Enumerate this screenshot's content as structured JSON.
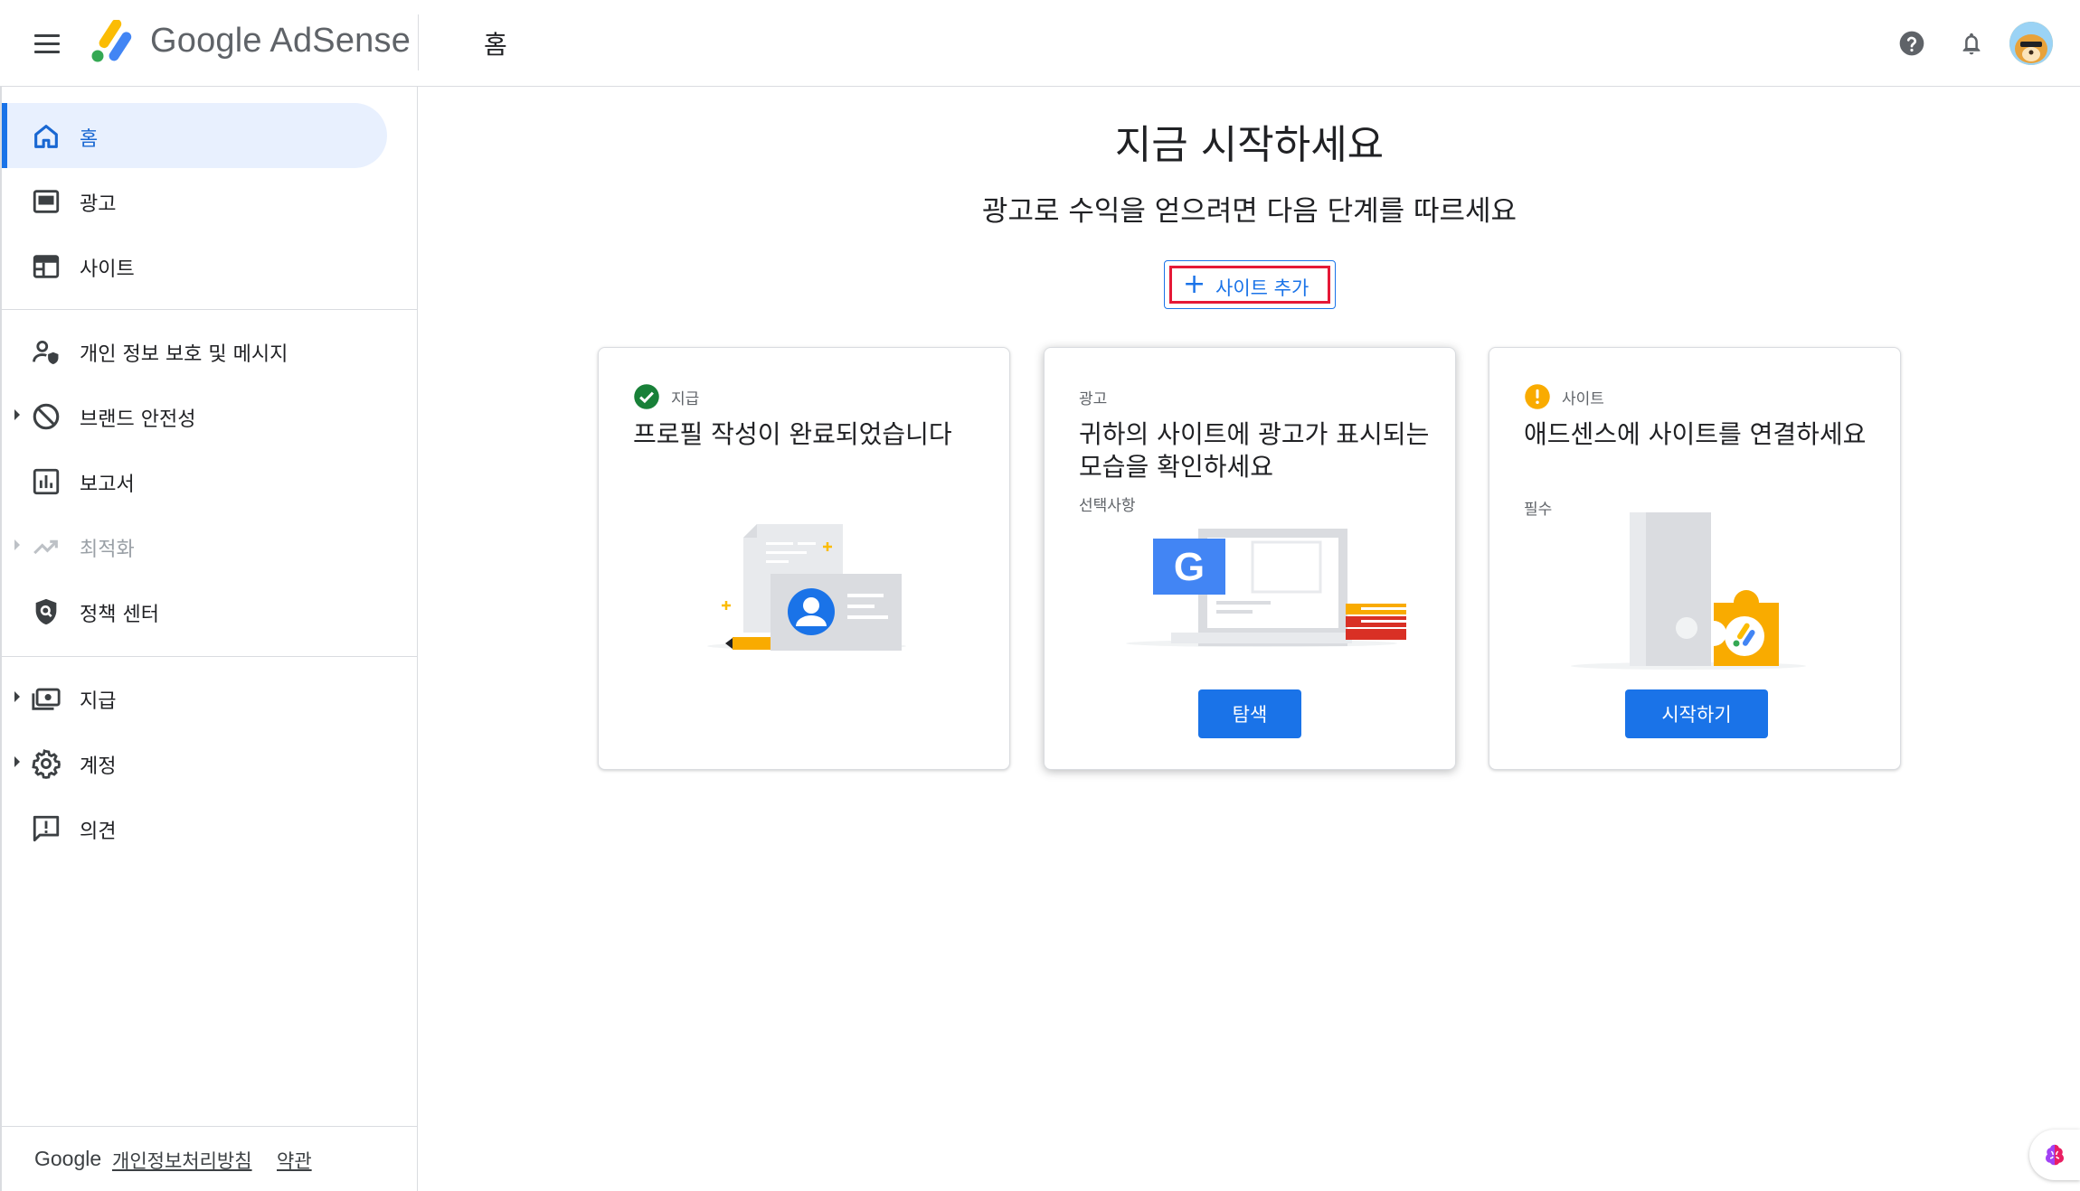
{
  "header": {
    "brand": "Google AdSense",
    "page_title": "홈",
    "icons": [
      "menu-icon",
      "help-icon",
      "notifications-icon",
      "avatar"
    ]
  },
  "sidebar": {
    "items": [
      {
        "label": "홈",
        "icon": "home-icon",
        "active": true
      },
      {
        "label": "광고",
        "icon": "ads-icon"
      },
      {
        "label": "사이트",
        "icon": "sites-icon"
      },
      {
        "label": "개인 정보 보호 및 메시지",
        "icon": "privacy-icon"
      },
      {
        "label": "브랜드 안전성",
        "icon": "block-icon",
        "expandable": true
      },
      {
        "label": "보고서",
        "icon": "reports-icon"
      },
      {
        "label": "최적화",
        "icon": "trending-icon",
        "expandable": true,
        "disabled": true
      },
      {
        "label": "정책 센터",
        "icon": "policy-icon"
      },
      {
        "label": "지급",
        "icon": "payments-icon",
        "expandable": true
      },
      {
        "label": "계정",
        "icon": "settings-icon",
        "expandable": true
      },
      {
        "label": "의견",
        "icon": "feedback-icon"
      }
    ],
    "footer": {
      "brand": "Google",
      "privacy_link": "개인정보처리방침",
      "terms_link": "약관"
    }
  },
  "main": {
    "title": "지금 시작하세요",
    "subtitle": "광고로 수익을 얻으려면 다음 단계를 따르세요",
    "add_site_button": "사이트 추가",
    "cards": [
      {
        "category": "지급",
        "status": "complete",
        "title": "프로필 작성이 완료되었습니다"
      },
      {
        "category": "광고",
        "title": "귀하의 사이트에 광고가 표시되는 모습을 확인하세요",
        "subtitle": "선택사항",
        "button": "탐색"
      },
      {
        "category": "사이트",
        "status": "warning",
        "title": "애드센스에 사이트를 연결하세요",
        "subtitle": "필수",
        "button": "시작하기"
      }
    ]
  },
  "colors": {
    "accent": "#1a73e8",
    "active_nav_bg": "#e8f0fe",
    "success": "#188038",
    "warning": "#f9ab00",
    "highlight": "#e51937"
  }
}
